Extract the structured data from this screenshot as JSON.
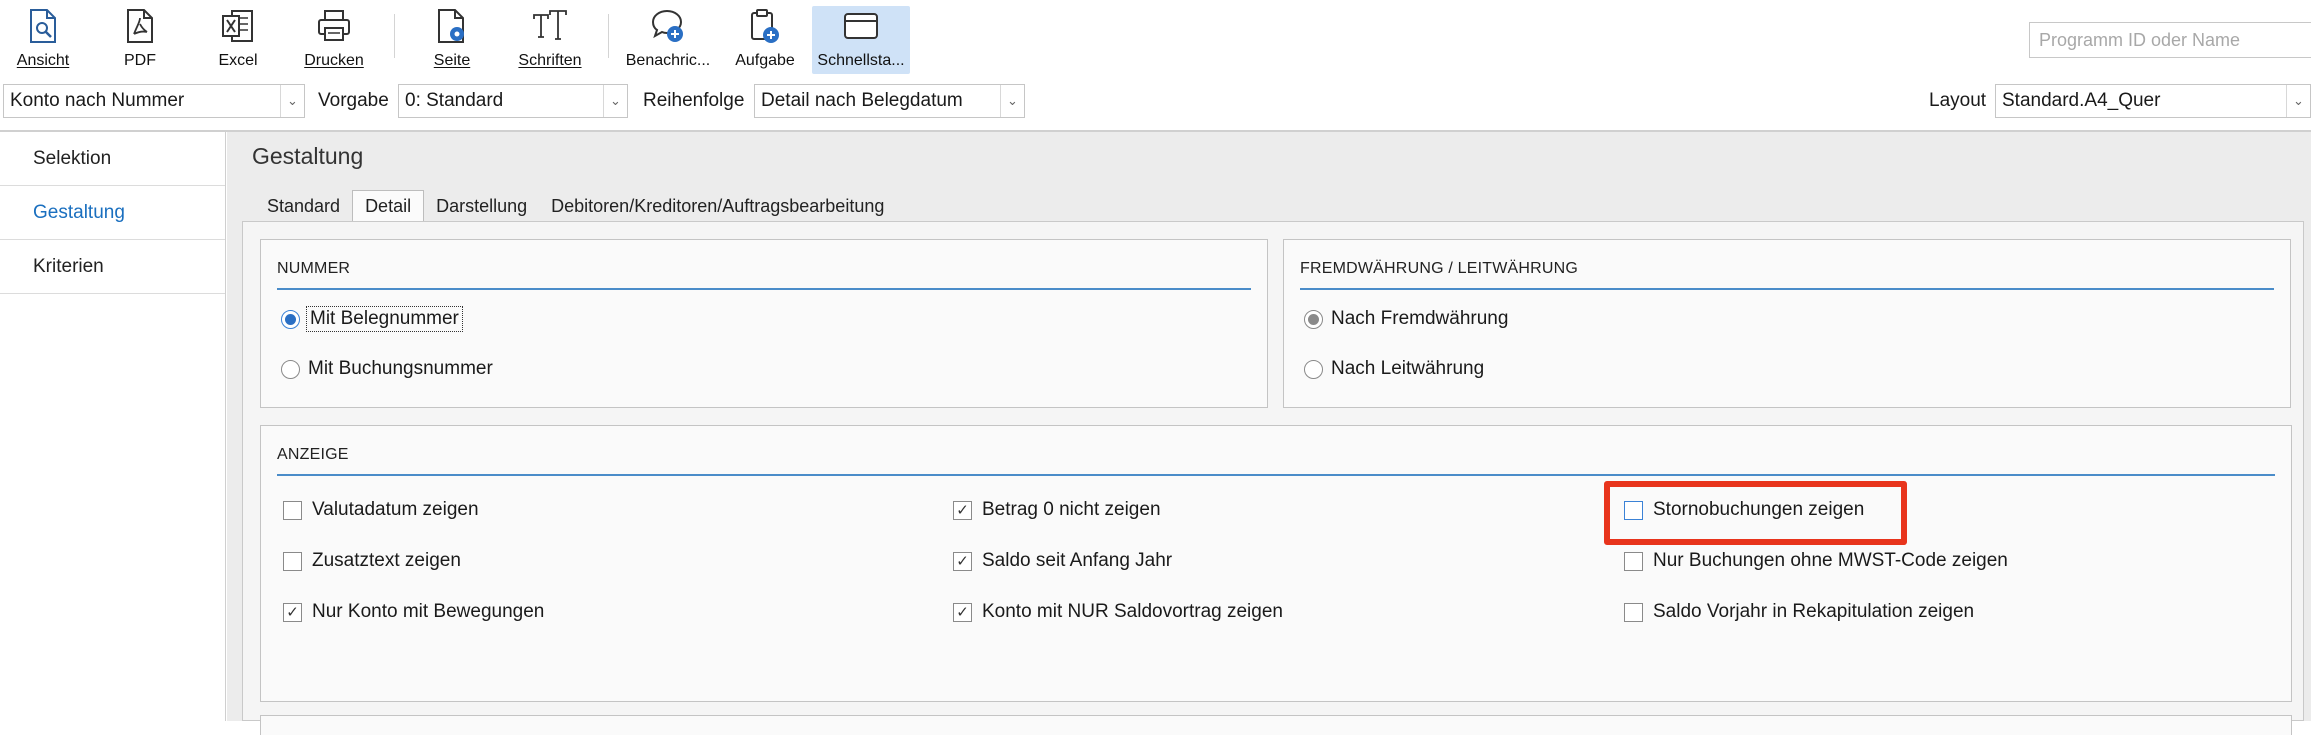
{
  "toolbar": {
    "items": [
      {
        "label": "Ansicht",
        "icon": "page-preview-icon"
      },
      {
        "label": "PDF",
        "icon": "pdf-icon"
      },
      {
        "label": "Excel",
        "icon": "excel-icon"
      },
      {
        "label": "Drucken",
        "icon": "printer-icon"
      },
      {
        "label": "Seite",
        "icon": "page-setup-icon"
      },
      {
        "label": "Schriften",
        "icon": "font-icon"
      },
      {
        "label": "Benachric...",
        "icon": "notification-add-icon"
      },
      {
        "label": "Aufgabe",
        "icon": "task-add-icon"
      },
      {
        "label": "Schnellsta...",
        "icon": "quickstart-window-icon"
      }
    ],
    "search_placeholder": "Programm ID oder Name"
  },
  "filters": {
    "account_order": "Konto nach Nummer",
    "vorgabe_label": "Vorgabe",
    "vorgabe_value": "0: Standard",
    "reihenfolge_label": "Reihenfolge",
    "reihenfolge_value": "Detail nach Belegdatum",
    "layout_label": "Layout",
    "layout_value": "Standard.A4_Quer"
  },
  "nav": {
    "items": [
      {
        "label": "Selektion"
      },
      {
        "label": "Gestaltung"
      },
      {
        "label": "Kriterien"
      }
    ],
    "active_index": 1
  },
  "main": {
    "title": "Gestaltung",
    "tabs": [
      "Standard",
      "Detail",
      "Darstellung",
      "Debitoren/Kreditoren/Auftragsbearbeitung"
    ],
    "active_tab": "Detail"
  },
  "nummer": {
    "title": "NUMMER",
    "options": [
      {
        "label": "Mit Belegnummer",
        "selected": true
      },
      {
        "label": "Mit Buchungsnummer",
        "selected": false
      }
    ]
  },
  "fremdwaehrung": {
    "title": "FREMDWÄHRUNG / LEITWÄHRUNG",
    "options": [
      {
        "label": "Nach Fremdwährung",
        "selected": true
      },
      {
        "label": "Nach Leitwährung",
        "selected": false
      }
    ]
  },
  "anzeige": {
    "title": "ANZEIGE",
    "checkboxes": [
      {
        "label": "Valutadatum zeigen",
        "checked": false
      },
      {
        "label": "Zusatztext zeigen",
        "checked": false
      },
      {
        "label": "Nur Konto mit Bewegungen",
        "checked": true
      },
      {
        "label": "Betrag 0 nicht zeigen",
        "checked": true
      },
      {
        "label": "Saldo seit Anfang Jahr",
        "checked": true
      },
      {
        "label": "Konto mit NUR Saldovortrag zeigen",
        "checked": true
      },
      {
        "label": "Stornobuchungen zeigen",
        "checked": false
      },
      {
        "label": "Nur Buchungen ohne MWST-Code zeigen",
        "checked": false
      },
      {
        "label": "Saldo Vorjahr in Rekapitulation zeigen",
        "checked": false
      }
    ]
  },
  "colors": {
    "accent": "#1a6fbf",
    "highlight": "#e8341c",
    "active_tab_bg": "#cfe2f7",
    "group_rule": "#4a8cc9"
  }
}
